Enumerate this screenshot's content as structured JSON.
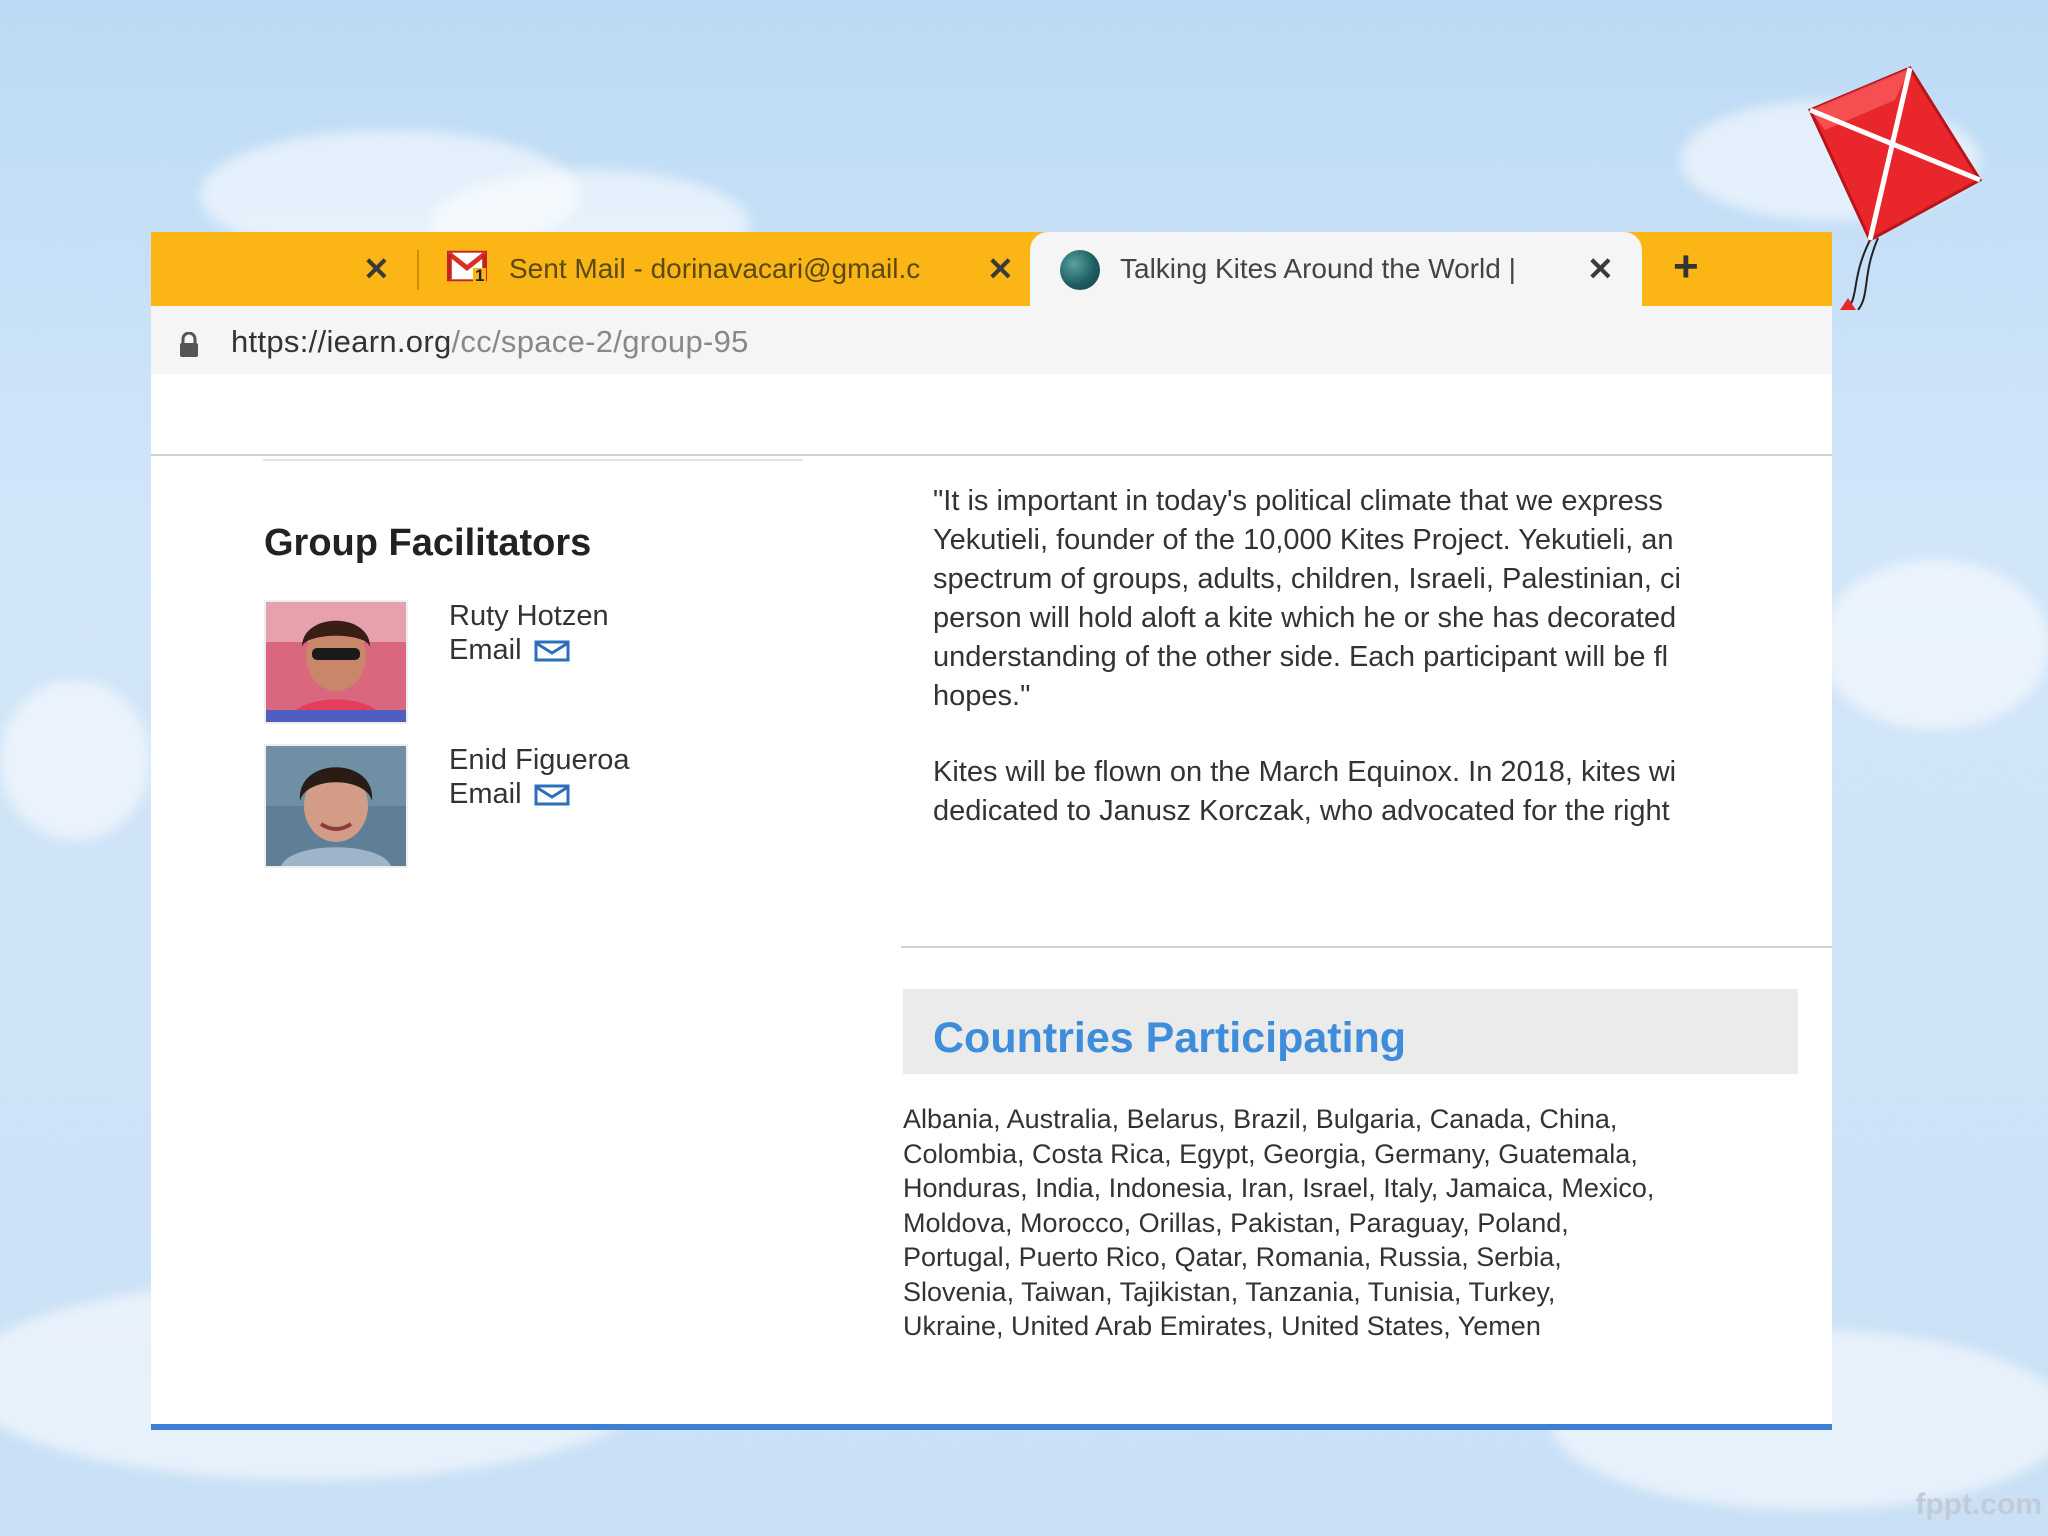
{
  "browser": {
    "tabs": [
      {
        "title": "",
        "close": "✕"
      },
      {
        "title": "Sent Mail - dorinavacari@gmail.c",
        "icon": "gmail-icon",
        "badge": "1",
        "close": "✕"
      },
      {
        "title": "Talking Kites Around the World |",
        "icon": "globe-icon",
        "close": "✕",
        "active": true
      }
    ],
    "new_tab": "+",
    "url_host": "https://iearn.org",
    "url_path": "/cc/space-2/group-95"
  },
  "facilitators": {
    "heading": "Group Facilitators",
    "people": [
      {
        "name": "Ruty Hotzen",
        "email_label": "Email"
      },
      {
        "name": "Enid Figueroa",
        "email_label": "Email"
      }
    ]
  },
  "description": {
    "lines": [
      "\"It is important in today's political climate that we express",
      "Yekutieli, founder of the 10,000 Kites Project. Yekutieli, an",
      "spectrum of groups, adults, children, Israeli, Palestinian, ci",
      "person will hold aloft a kite which he or she has decorated",
      "understanding of the other side. Each participant will be fl",
      "hopes.\""
    ],
    "lines2": [
      "Kites will be flown on the March Equinox. In 2018, kites wi",
      "dedicated to Janusz Korczak, who advocated for the right"
    ]
  },
  "countries": {
    "title": "Countries Participating",
    "lines": [
      "Albania, Australia, Belarus, Brazil, Bulgaria, Canada, China,",
      "Colombia, Costa Rica, Egypt, Georgia, Germany, Guatemala,",
      "Honduras, India, Indonesia, Iran, Israel, Italy, Jamaica, Mexico,",
      "Moldova, Morocco, Orillas, Pakistan, Paraguay, Poland,",
      "Portugal, Puerto Rico, Qatar, Romania, Russia, Serbia,",
      "Slovenia, Taiwan, Tajikistan, Tanzania, Tunisia, Turkey,",
      "Ukraine, United Arab Emirates, United States, Yemen"
    ]
  },
  "watermark": "fppt.com",
  "colors": {
    "tabstrip": "#fbb615",
    "link_blue": "#3d8ddb",
    "bottom_bar": "#3e7fd6",
    "sky": "#cfe3f7"
  }
}
